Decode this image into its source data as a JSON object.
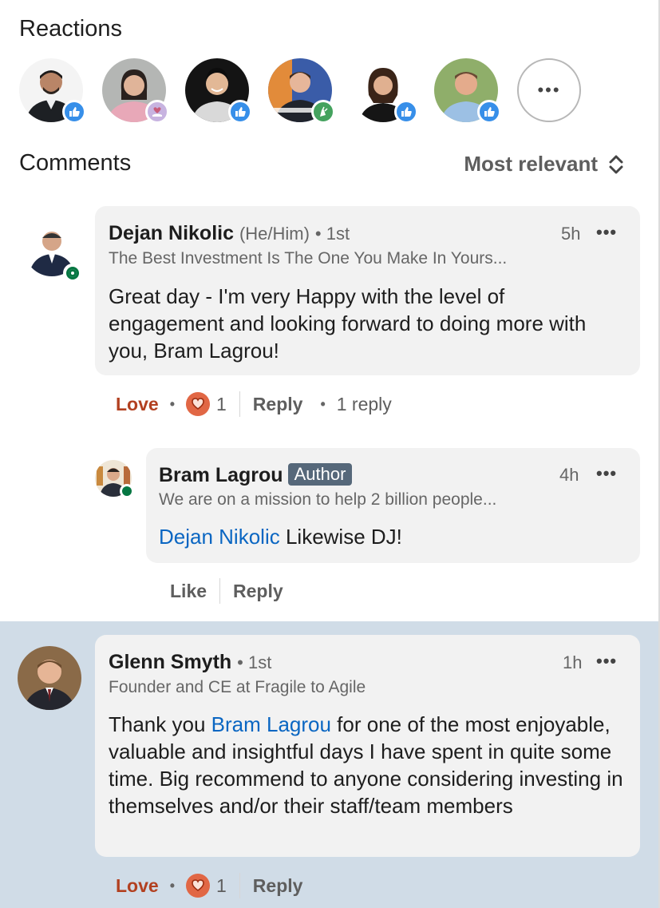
{
  "reactions": {
    "title": "Reactions",
    "reactors": [
      {
        "name": "reactor-1",
        "reaction": "like-icon"
      },
      {
        "name": "reactor-2",
        "reaction": "support-icon"
      },
      {
        "name": "reactor-3",
        "reaction": "like-icon"
      },
      {
        "name": "reactor-4",
        "reaction": "celebrate-icon"
      },
      {
        "name": "reactor-5",
        "reaction": "like-icon"
      },
      {
        "name": "reactor-6",
        "reaction": "like-icon"
      }
    ],
    "more_label": "•••"
  },
  "comments": {
    "title": "Comments",
    "sort_label": "Most relevant",
    "items": [
      {
        "author": "Dejan Nikolic",
        "pronouns": "(He/Him)",
        "degree": "• 1st",
        "time": "5h",
        "headline": "The Best Investment Is The One You Make In Yours...",
        "text": "Great day - I'm very Happy with the level of engagement and looking forward to doing more with you, Bram Lagrou!",
        "reaction_label": "Love",
        "reaction_count": "1",
        "reply_label": "Reply",
        "reply_count": "1 reply",
        "reply": {
          "author": "Bram Lagrou",
          "badge": "Author",
          "time": "4h",
          "headline": "We are on a mission to help 2 billion people...",
          "mention": "Dejan Nikolic",
          "text": " Likewise DJ!",
          "like_label": "Like",
          "reply_label": "Reply"
        }
      },
      {
        "author": "Glenn Smyth",
        "degree": "• 1st",
        "time": "1h",
        "headline": "Founder and CE at Fragile to Agile",
        "text_before": "Thank you ",
        "mention": "Bram Lagrou",
        "text_after": " for one of the most enjoyable, valuable and insightful days I have spent in quite some time. Big recommend to anyone considering investing in themselves and/or their staff/team members",
        "reaction_label": "Love",
        "reaction_count": "1",
        "reply_label": "Reply"
      }
    ],
    "more_options": "•••"
  },
  "colors": {
    "like": "#378fe9",
    "love": "#e16745",
    "love_label": "#b24020",
    "mention": "#0a66c2",
    "online": "#057642",
    "highlight_bg": "#d0dce7",
    "bubble_bg": "#f2f2f2"
  }
}
